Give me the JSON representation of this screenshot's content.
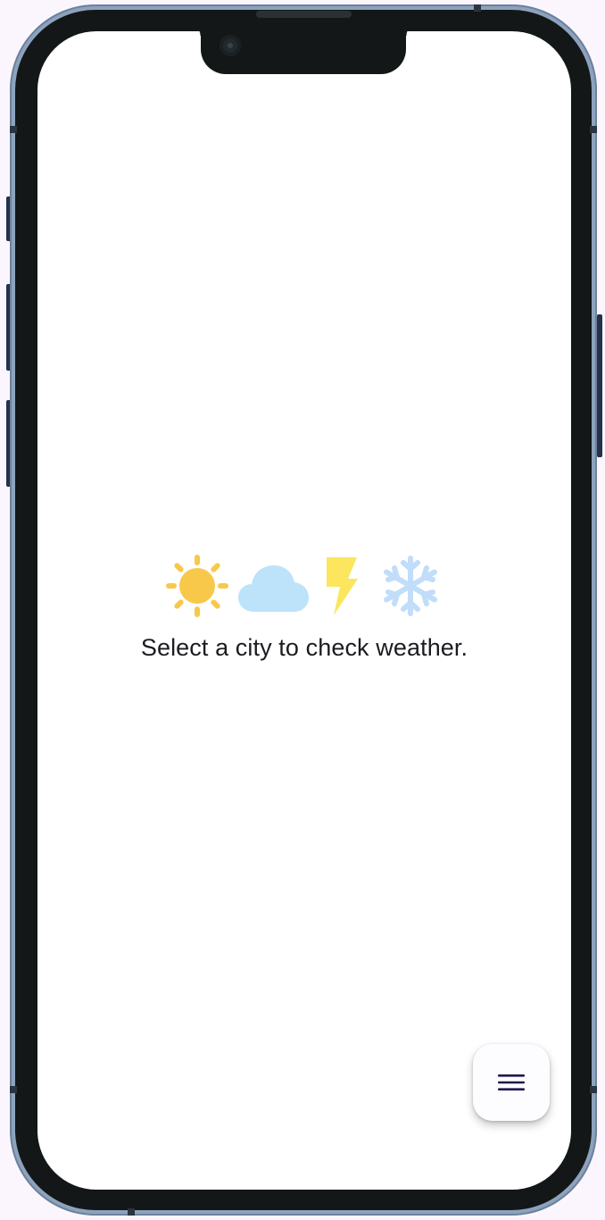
{
  "main": {
    "prompt_text": "Select a city to check weather."
  },
  "icons": {
    "sun": "sun-icon",
    "cloud": "cloud-icon",
    "lightning": "lightning-icon",
    "snowflake": "snowflake-icon",
    "menu": "menu-icon"
  },
  "colors": {
    "sun": "#f8c84a",
    "cloud": "#bde3fa",
    "lightning": "#fbe65e",
    "snowflake": "#c1ddfa",
    "fab_icon": "#1f1a4f",
    "frame": "#8da3bd",
    "bezel": "#141717"
  }
}
